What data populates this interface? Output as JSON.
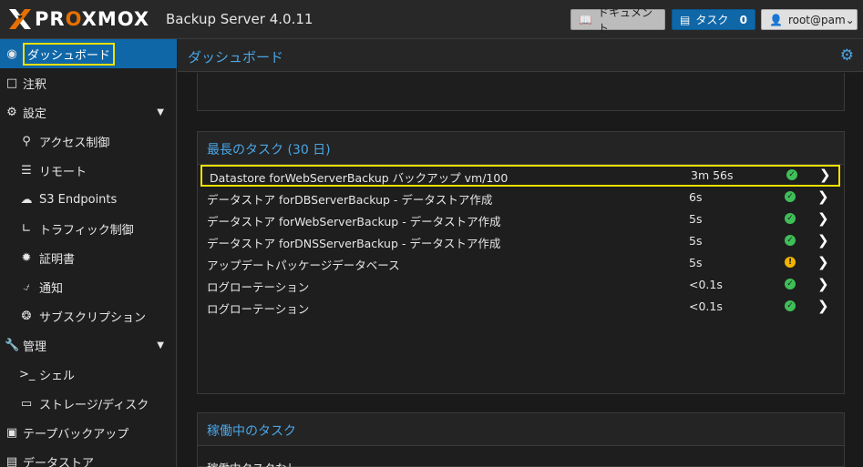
{
  "header": {
    "logo_text_pre": "PR",
    "logo_text_o": "O",
    "logo_text_post": "XMOX",
    "product": "Backup Server 4.0.11",
    "docs_label": "ドキュメント",
    "tasks_label": "タスク",
    "tasks_count": "0",
    "user_label": "root@pam"
  },
  "sidebar": {
    "items": [
      {
        "label": "ダッシュボード",
        "icon": "dashboard-icon"
      },
      {
        "label": "注釈",
        "icon": "note-icon"
      },
      {
        "label": "設定",
        "icon": "cogs-icon"
      },
      {
        "label": "アクセス制御",
        "icon": "key-icon"
      },
      {
        "label": "リモート",
        "icon": "server-icon"
      },
      {
        "label": "S3 Endpoints",
        "icon": "cloud-upload-icon"
      },
      {
        "label": "トラフィック制御",
        "icon": "chart-icon"
      },
      {
        "label": "証明書",
        "icon": "certificate-icon"
      },
      {
        "label": "通知",
        "icon": "bell-icon"
      },
      {
        "label": "サブスクリプション",
        "icon": "support-icon"
      },
      {
        "label": "管理",
        "icon": "wrench-icon"
      },
      {
        "label": "シェル",
        "icon": "terminal-icon"
      },
      {
        "label": "ストレージ/ディスク",
        "icon": "hdd-icon"
      },
      {
        "label": "テープバックアップ",
        "icon": "tape-icon"
      },
      {
        "label": "データストア",
        "icon": "database-icon"
      }
    ]
  },
  "main": {
    "title": "ダッシュボード",
    "longest_tasks": {
      "title": "最長のタスク (30 日)",
      "rows": [
        {
          "name": "Datastore forWebServerBackup バックアップ vm/100",
          "duration": "3m 56s",
          "status": "ok"
        },
        {
          "name": "データストア forDBServerBackup - データストア作成",
          "duration": "6s",
          "status": "ok"
        },
        {
          "name": "データストア forWebServerBackup - データストア作成",
          "duration": "5s",
          "status": "ok"
        },
        {
          "name": "データストア forDNSServerBackup - データストア作成",
          "duration": "5s",
          "status": "ok"
        },
        {
          "name": "アップデートパッケージデータベース",
          "duration": "5s",
          "status": "warning"
        },
        {
          "name": "ログローテーション",
          "duration": "<0.1s",
          "status": "ok"
        },
        {
          "name": "ログローテーション",
          "duration": "<0.1s",
          "status": "ok"
        }
      ]
    },
    "running_tasks": {
      "title": "稼働中のタスク",
      "empty_text": "稼働中タスクなし"
    }
  },
  "colors": {
    "accent": "#0f67a8",
    "link": "#4aa6e6",
    "highlight": "#f0e000",
    "ok": "#3fbf58",
    "warning": "#f0b400"
  }
}
